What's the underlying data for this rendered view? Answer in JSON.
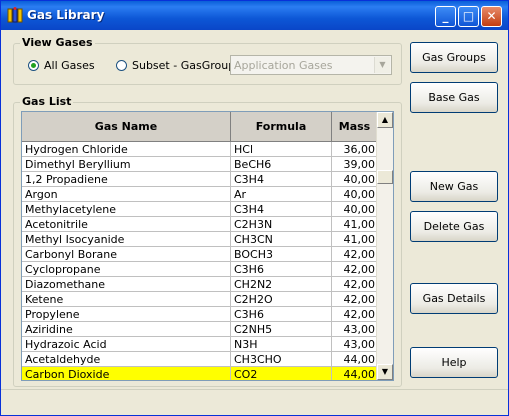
{
  "window": {
    "title": "Gas Library",
    "btn_min": "_",
    "btn_max": "□",
    "btn_close": "✕"
  },
  "view_gases": {
    "label": "View Gases",
    "all_label": "All Gases",
    "all_selected": true,
    "subset_label": "Subset - GasGroup",
    "subset_selected": false,
    "group_value": "Application Gases"
  },
  "gas_list": {
    "label": "Gas List",
    "columns": [
      "Gas Name",
      "Formula",
      "Mass"
    ],
    "rows": [
      {
        "name": "Hydrogen Chloride",
        "formula": "HCl",
        "mass": "36,00"
      },
      {
        "name": "Dimethyl Beryllium",
        "formula": "BeCH6",
        "mass": "39,00"
      },
      {
        "name": "1,2 Propadiene",
        "formula": "C3H4",
        "mass": "40,00"
      },
      {
        "name": "Argon",
        "formula": "Ar",
        "mass": "40,00"
      },
      {
        "name": "Methylacetylene",
        "formula": "C3H4",
        "mass": "40,00"
      },
      {
        "name": "Acetonitrile",
        "formula": "C2H3N",
        "mass": "41,00"
      },
      {
        "name": "Methyl Isocyanide",
        "formula": "CH3CN",
        "mass": "41,00"
      },
      {
        "name": "Carbonyl Borane",
        "formula": "BOCH3",
        "mass": "42,00"
      },
      {
        "name": "Cyclopropane",
        "formula": "C3H6",
        "mass": "42,00"
      },
      {
        "name": "Diazomethane",
        "formula": "CH2N2",
        "mass": "42,00"
      },
      {
        "name": "Ketene",
        "formula": "C2H2O",
        "mass": "42,00"
      },
      {
        "name": "Propylene",
        "formula": "C3H6",
        "mass": "42,00"
      },
      {
        "name": "Aziridine",
        "formula": "C2NH5",
        "mass": "43,00"
      },
      {
        "name": "Hydrazoic Acid",
        "formula": "N3H",
        "mass": "43,00"
      },
      {
        "name": "Acetaldehyde",
        "formula": "CH3CHO",
        "mass": "44,00"
      },
      {
        "name": "Carbon Dioxide",
        "formula": "CO2",
        "mass": "44,00",
        "selected": true
      }
    ]
  },
  "buttons": {
    "gas_groups": "Gas Groups",
    "base_gas": "Base Gas",
    "new_gas": "New Gas",
    "delete_gas": "Delete Gas",
    "gas_details": "Gas Details",
    "help": "Help"
  },
  "colors": {
    "selection": "#ffff00",
    "title_bar": "#0a5fd8"
  }
}
